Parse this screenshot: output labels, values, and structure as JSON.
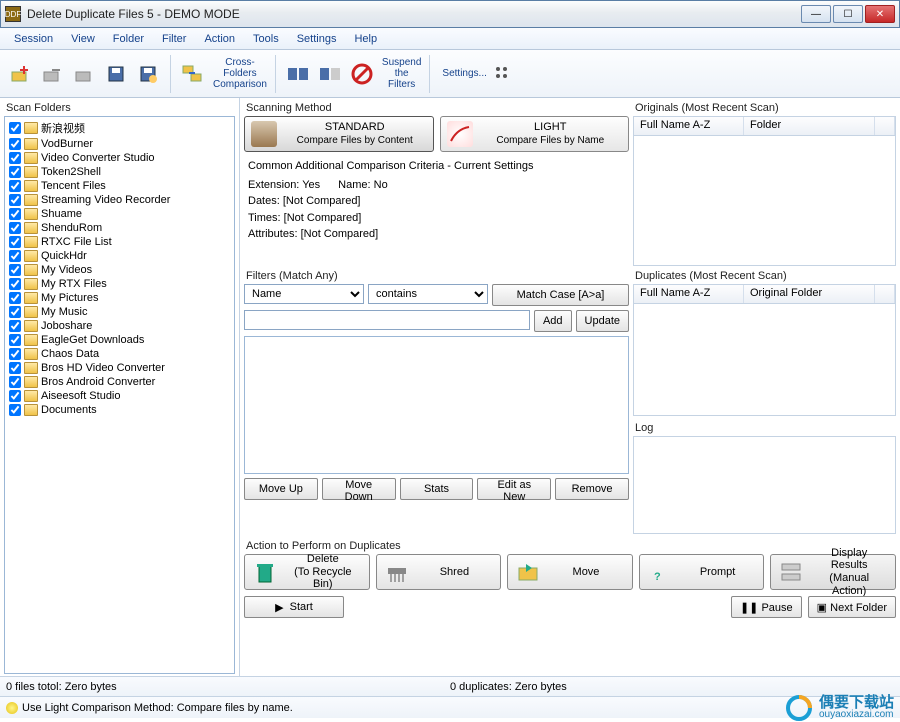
{
  "window": {
    "title": "Delete Duplicate Files 5 - DEMO MODE"
  },
  "menu": [
    "Session",
    "View",
    "Folder",
    "Filter",
    "Action",
    "Tools",
    "Settings",
    "Help"
  ],
  "toolbar": {
    "cross_folders": "Cross-\nFolders\nComparison",
    "suspend_filters": "Suspend\nthe\nFilters",
    "settings": "Settings..."
  },
  "scan_folders": {
    "title": "Scan Folders",
    "items": [
      "新浪视频",
      "VodBurner",
      "Video Converter Studio",
      "Token2Shell",
      "Tencent Files",
      "Streaming Video Recorder",
      "Shuame",
      "ShenduRom",
      "RTXC File List",
      "QuickHdr",
      "My Videos",
      "My RTX Files",
      "My Pictures",
      "My Music",
      "Joboshare",
      "EagleGet Downloads",
      "Chaos Data",
      "Bros HD Video Converter",
      "Bros Android Converter",
      "Aiseesoft Studio",
      "Documents"
    ]
  },
  "scanning_method": {
    "title": "Scanning Method",
    "standard": {
      "line1": "STANDARD",
      "line2": "Compare Files by Content"
    },
    "light": {
      "line1": "LIGHT",
      "line2": "Compare Files by Name"
    }
  },
  "criteria": {
    "title": "Common Additional Comparison Criteria - Current Settings",
    "extension": "Extension: Yes",
    "name": "Name: No",
    "dates": "Dates:  [Not Compared]",
    "times": "Times:  [Not Compared]",
    "attributes": "Attributes:  [Not Compared]"
  },
  "filters": {
    "title": "Filters (Match Any)",
    "field_options": [
      "Name"
    ],
    "op_options": [
      "contains"
    ],
    "match_case": "Match Case [A>a]",
    "add": "Add",
    "update": "Update",
    "move_up": "Move Up",
    "move_down": "Move Down",
    "stats": "Stats",
    "edit_as_new": "Edit as New",
    "remove": "Remove"
  },
  "originals": {
    "title": "Originals (Most Recent Scan)",
    "col1": "Full Name A-Z",
    "col2": "Folder"
  },
  "duplicates": {
    "title": "Duplicates (Most Recent Scan)",
    "col1": "Full Name A-Z",
    "col2": "Original Folder"
  },
  "log": {
    "title": "Log"
  },
  "actions": {
    "title": "Action to Perform on Duplicates",
    "delete": {
      "line1": "Delete",
      "line2": "(To Recycle Bin)"
    },
    "shred": "Shred",
    "move": "Move",
    "prompt": "Prompt",
    "display": {
      "line1": "Display Results",
      "line2": "(Manual Action)"
    }
  },
  "bottom": {
    "start": "Start",
    "pause": "Pause",
    "next_folder": "Next Folder"
  },
  "status": {
    "files_total": "0 files totol: Zero bytes",
    "duplicates": "0 duplicates: Zero bytes"
  },
  "hint": "Use Light Comparison Method: Compare files by name.",
  "watermark": {
    "text": "偶要下载站",
    "url": "ouyaoxiazai.com"
  }
}
